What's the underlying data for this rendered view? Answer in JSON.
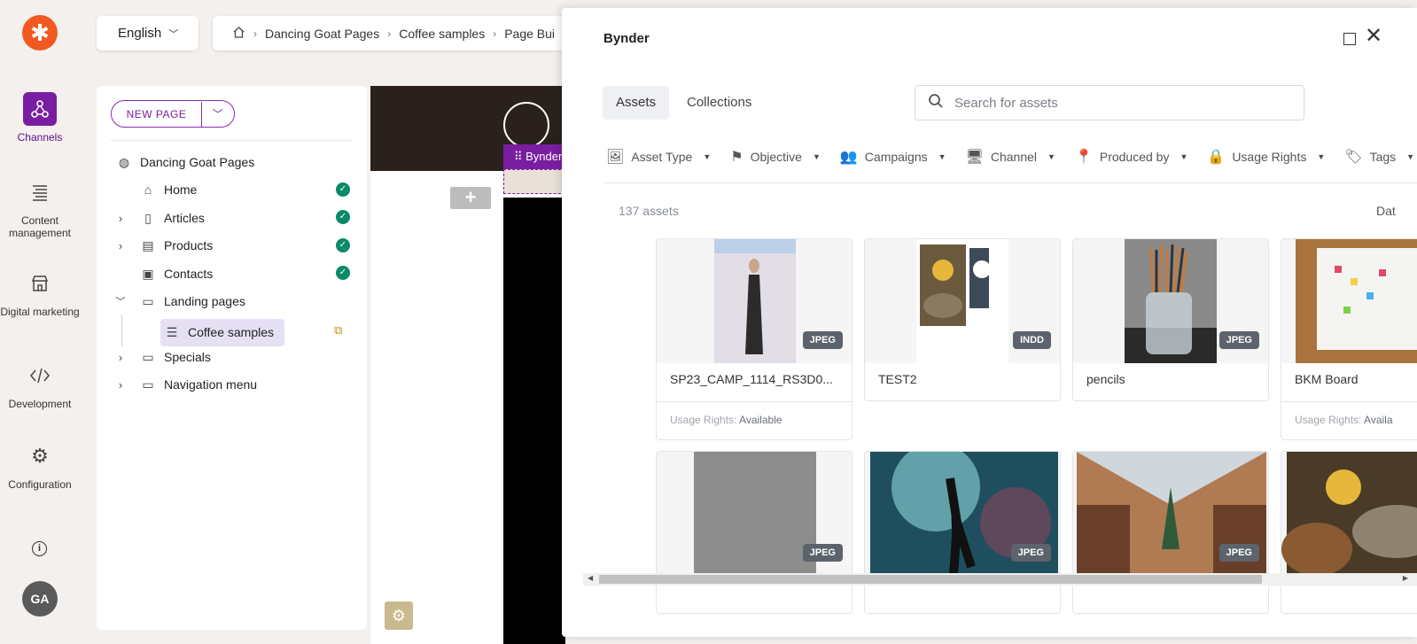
{
  "rail": {
    "items": [
      {
        "label": "Channels"
      },
      {
        "label": "Content management"
      },
      {
        "label": "Digital marketing"
      },
      {
        "label": "Development"
      },
      {
        "label": "Configuration"
      }
    ],
    "avatar": "GA"
  },
  "header": {
    "language": "English",
    "breadcrumb": [
      "Dancing Goat Pages",
      "Coffee samples",
      "Page Bui"
    ]
  },
  "tree": {
    "new_page_label": "NEW PAGE",
    "nodes": [
      {
        "label": "Dancing Goat Pages"
      },
      {
        "label": "Home"
      },
      {
        "label": "Articles"
      },
      {
        "label": "Products"
      },
      {
        "label": "Contacts"
      },
      {
        "label": "Landing pages"
      },
      {
        "label": "Coffee samples"
      },
      {
        "label": "Specials"
      },
      {
        "label": "Navigation menu"
      }
    ]
  },
  "preview": {
    "widget_label": "Bynder"
  },
  "modal": {
    "title": "Bynder",
    "tabs": [
      "Assets",
      "Collections"
    ],
    "search_placeholder": "Search for assets",
    "filters": [
      "Asset Type",
      "Objective",
      "Campaigns",
      "Channel",
      "Produced by",
      "Usage Rights",
      "Tags"
    ],
    "asset_count": "137 assets",
    "sort_label": "Dat",
    "assets": [
      {
        "name": "SP23_CAMP_1114_RS3D0...",
        "type": "JPEG",
        "usage_label": "Usage Rights:",
        "usage_value": "Available"
      },
      {
        "name": "TEST2",
        "type": "INDD"
      },
      {
        "name": "pencils",
        "type": "JPEG"
      },
      {
        "name": "BKM Board",
        "usage_label": "Usage Rights:",
        "usage_value": "Availa"
      },
      {
        "type": "JPEG"
      },
      {
        "type": "JPEG"
      },
      {
        "type": "JPEG"
      },
      {}
    ]
  },
  "colors": {
    "brand_purple": "#7a1ea1",
    "kentico_orange": "#f05a22",
    "check_green": "#0b8a6a"
  }
}
